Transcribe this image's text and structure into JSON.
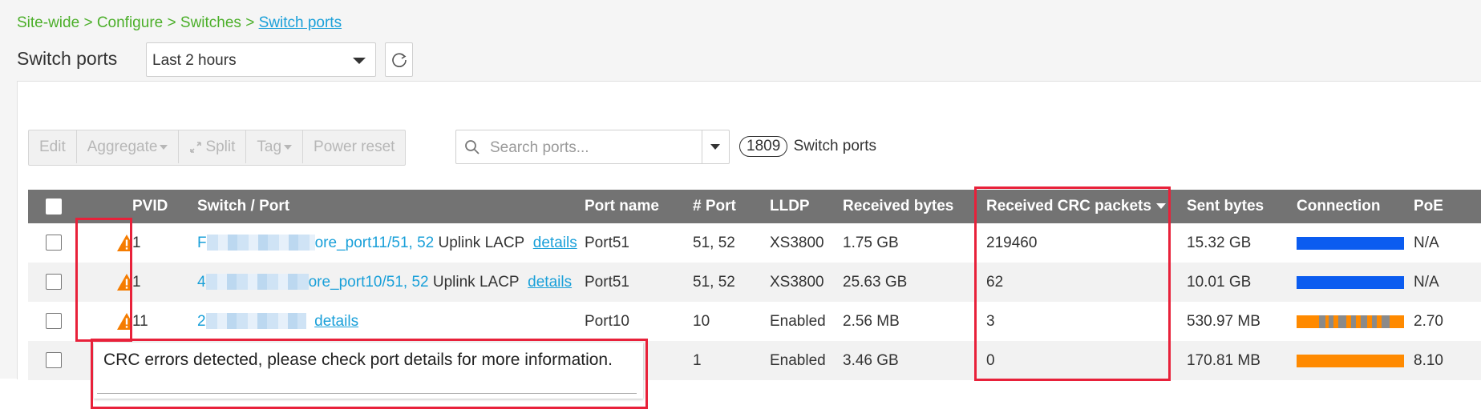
{
  "breadcrumb": {
    "items": [
      "Site-wide",
      "Configure",
      "Switches"
    ],
    "separator": ">",
    "current": "Switch ports"
  },
  "page_title": "Switch ports",
  "time_range": {
    "selected": "Last 2 hours"
  },
  "toolbar": {
    "edit": "Edit",
    "aggregate": "Aggregate",
    "split": "Split",
    "tag": "Tag",
    "power_reset": "Power reset"
  },
  "search": {
    "placeholder": "Search ports..."
  },
  "port_count": {
    "value": "1809",
    "label": "Switch ports"
  },
  "table": {
    "columns": {
      "pvid": "PVID",
      "switch_port": "Switch / Port",
      "port_name": "Port name",
      "port_num": "# Port",
      "lldp": "LLDP",
      "received_bytes": "Received bytes",
      "received_crc": "Received CRC packets",
      "sent_bytes": "Sent bytes",
      "connection": "Connection",
      "poe": "PoE"
    },
    "rows": [
      {
        "warning": true,
        "pvid": "1",
        "prefix": "F",
        "switch": "ore_port11/51, 52",
        "desc": " Uplink LACP",
        "details": "details",
        "port_name": "Port51",
        "port_num": "51, 52",
        "lldp": "XS3800",
        "received_bytes": "1.75 GB",
        "received_crc": "219460",
        "sent_bytes": "15.32 GB",
        "connection": "full-blue",
        "poe": "N/A"
      },
      {
        "warning": true,
        "pvid": "1",
        "prefix": "4",
        "switch": "ore_port10/51, 52",
        "desc": " Uplink LACP",
        "details": "details",
        "port_name": "Port51",
        "port_num": "51, 52",
        "lldp": "XS3800",
        "received_bytes": "25.63 GB",
        "received_crc": "62",
        "sent_bytes": "10.01 GB",
        "connection": "full-blue",
        "poe": "N/A"
      },
      {
        "warning": true,
        "pvid": "11",
        "prefix": "2",
        "switch": "",
        "desc": "",
        "details": "details",
        "port_name": "Port10",
        "port_num": "10",
        "lldp": "Enabled",
        "received_bytes": "2.56 MB",
        "received_crc": "3",
        "sent_bytes": "530.97 MB",
        "connection": "orange-gray",
        "poe": "2.70"
      },
      {
        "warning": false,
        "pvid": "",
        "prefix": "",
        "switch": "",
        "desc": "",
        "details": "",
        "port_name": "",
        "port_num": "1",
        "lldp": "Enabled",
        "received_bytes": "3.46 GB",
        "received_crc": "0",
        "sent_bytes": "170.81 MB",
        "connection": "full-orange",
        "poe": "8.10"
      }
    ]
  },
  "tooltip": {
    "text": "CRC errors detected, please check port details for more information."
  },
  "colors": {
    "breadcrumb": "#4caf2a",
    "link": "#1aa0d9",
    "header_bg": "#737373",
    "warning": "#f57c00",
    "conn_blue": "#0b5cf0",
    "conn_orange": "#ff8a00",
    "conn_gray": "#8a8a8a",
    "highlight": "#e8213a"
  }
}
